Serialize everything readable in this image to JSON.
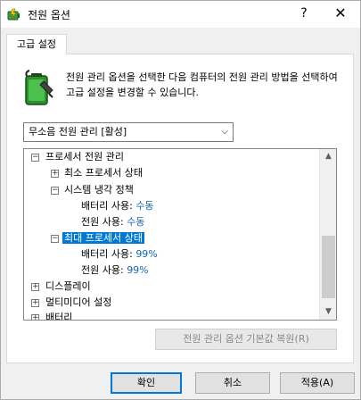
{
  "window": {
    "title": "전원 옵션",
    "help_label": "?",
    "close_label": "✕"
  },
  "tab": {
    "label": "고급 설정"
  },
  "description": {
    "text": "전원 관리 옵션을 선택한 다음 컴퓨터의 전원 관리 방법을 선택하여 고급 설정을 변경할 수 있습니다."
  },
  "plan_select": {
    "value": "무소음 전원 관리 [활성]"
  },
  "tree": {
    "items": [
      {
        "expander": "−",
        "label": "프로세서 전원 관리"
      },
      {
        "expander": "+",
        "label": "최소 프로세서 상태"
      },
      {
        "expander": "−",
        "label": "시스템 냉각 정책"
      },
      {
        "label": "배터리 사용:",
        "value": "수동"
      },
      {
        "label": "전원 사용:",
        "value": "수동"
      },
      {
        "expander": "−",
        "label": "최대 프로세서 상태"
      },
      {
        "label": "배터리 사용:",
        "value": "99%"
      },
      {
        "label": "전원 사용:",
        "value": "99%"
      },
      {
        "expander": "+",
        "label": "디스플레이"
      },
      {
        "expander": "+",
        "label": "멀티미디어 설정"
      },
      {
        "expander": "+",
        "label": "배터리"
      }
    ],
    "scroll_up": "▲",
    "scroll_down": "▼"
  },
  "restore_button": {
    "label": "전원 관리 옵션 기본값 복원(R)"
  },
  "buttons": {
    "ok": "확인",
    "cancel": "취소",
    "apply": "적용(A)"
  },
  "colors": {
    "accent": "#0078d7",
    "value_text": "#1066b3"
  }
}
